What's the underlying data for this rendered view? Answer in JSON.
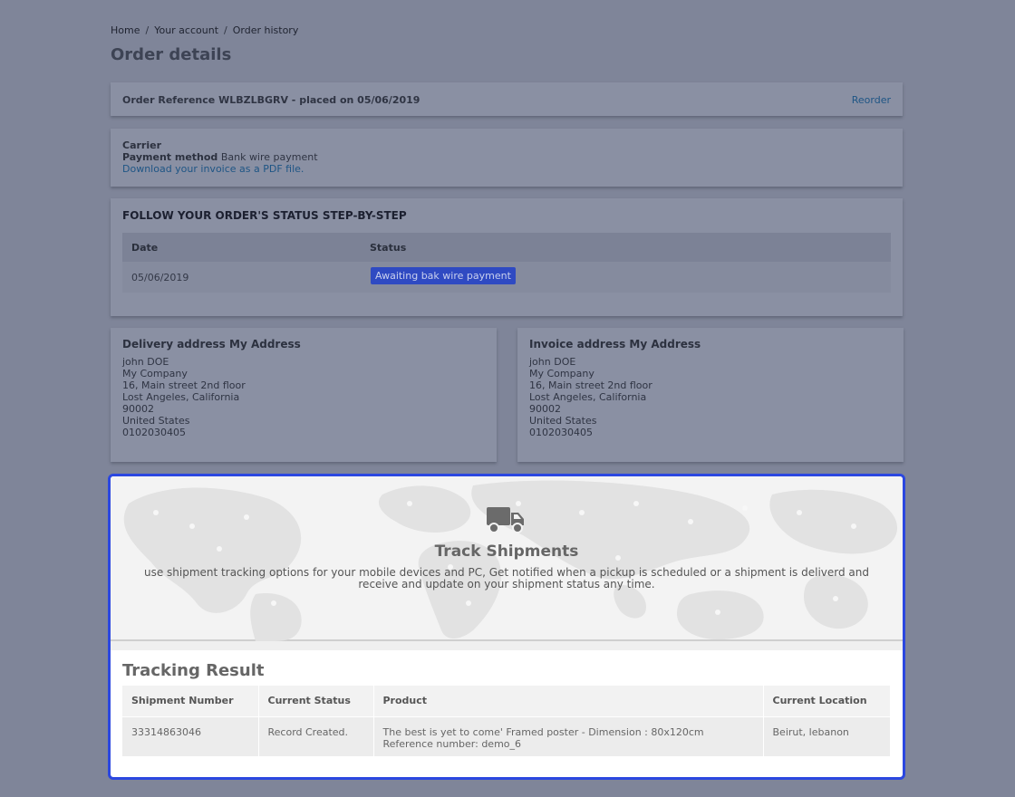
{
  "breadcrumb": {
    "items": [
      "Home",
      "Your account",
      "Order history"
    ],
    "separator": "/"
  },
  "page_title": "Order details",
  "order_ref": {
    "text": "Order Reference WLBZLBGRV - placed on 05/06/2019",
    "reorder_label": "Reorder"
  },
  "carrier_block": {
    "carrier_label": "Carrier",
    "payment_label": "Payment method",
    "payment_value": "Bank wire payment",
    "invoice_link": "Download your invoice as a PDF file."
  },
  "status_section": {
    "title": "FOLLOW YOUR ORDER'S STATUS STEP-BY-STEP",
    "columns": [
      "Date",
      "Status"
    ],
    "rows": [
      {
        "date": "05/06/2019",
        "status": "Awaiting bak wire payment"
      }
    ]
  },
  "delivery_address": {
    "title": "Delivery address My Address",
    "lines": [
      "john DOE",
      "My Company",
      "16, Main street 2nd floor",
      "Lost Angeles, California",
      "90002",
      "United States",
      "0102030405"
    ]
  },
  "invoice_address": {
    "title": "Invoice address My Address",
    "lines": [
      "john DOE",
      "My Company",
      "16, Main street 2nd floor",
      "Lost Angeles, California",
      "90002",
      "United States",
      "0102030405"
    ]
  },
  "tracking": {
    "hero_icon": "truck-icon",
    "hero_title": "Track Shipments",
    "hero_text": "use shipment tracking options for your mobile devices and PC, Get notified when a pickup is scheduled or a shipment is deliverd and receive and update on your shipment status any time.",
    "result_title": "Tracking Result",
    "columns": [
      "Shipment Number",
      "Current Status",
      "Product",
      "Current Location"
    ],
    "rows": [
      {
        "shipment_number": "33314863046",
        "status": "Record Created.",
        "product_line1": "The best is yet to come' Framed poster - Dimension : 80x120cm",
        "product_line2": "Reference number: demo_6",
        "location": "Beirut, lebanon"
      }
    ]
  },
  "colors": {
    "overlay": "#7f8599",
    "highlight_border": "#2b47e0",
    "status_badge": "#2f4ac2",
    "link": "#1e5585"
  }
}
